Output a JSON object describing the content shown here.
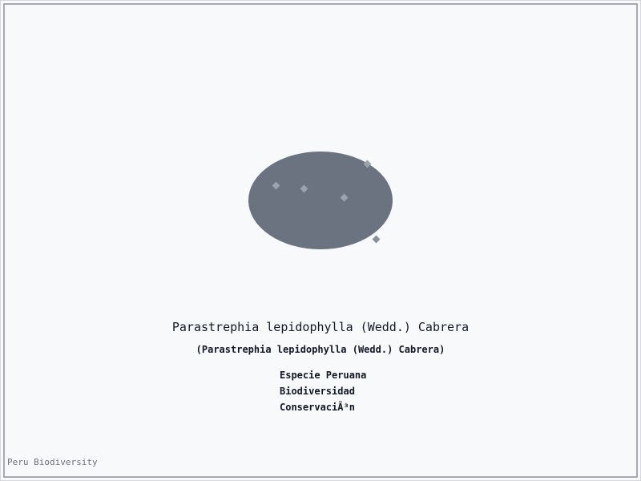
{
  "illustration": {
    "icon": "species-distribution-blob-icon",
    "fill_color": "#6b7280",
    "marker_color": "#9ca3af",
    "marker_shape": "diamond"
  },
  "species": {
    "title": "Parastrephia lepidophylla (Wedd.) Cabrera",
    "subtitle": "(Parastrephia lepidophylla (Wedd.) Cabrera)"
  },
  "tags": [
    "Especie Peruana",
    "Biodiversidad",
    "ConservaciÃ³n"
  ],
  "footer": {
    "text": "Peru Biodiversity"
  },
  "colors": {
    "background": "#f8f9fb",
    "border": "#a6a9b0",
    "text": "#111827",
    "muted_text": "#6b7280"
  }
}
